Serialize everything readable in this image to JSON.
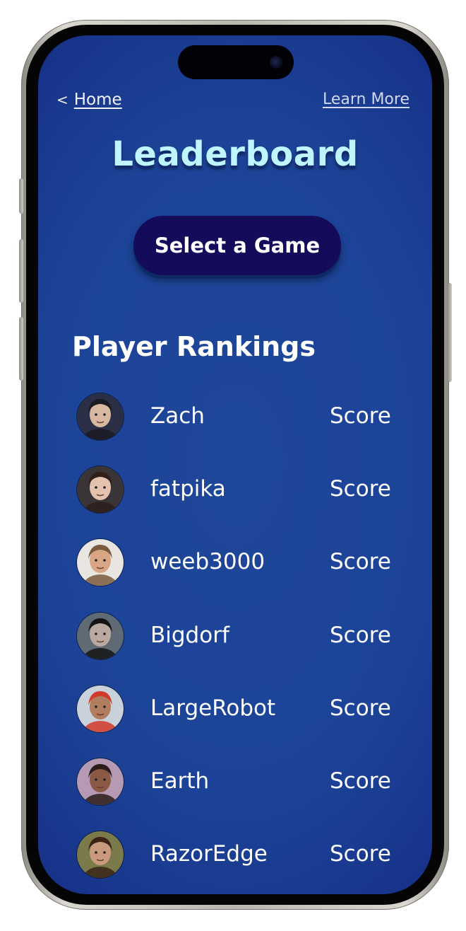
{
  "nav": {
    "back_arrow": "<",
    "home_label": "Home",
    "learn_more_label": "Learn More"
  },
  "page": {
    "title": "Leaderboard",
    "select_game_label": "Select a Game",
    "section_title": "Player Rankings"
  },
  "players": [
    {
      "name": "Zach",
      "score": "Score",
      "avatar_bg": "#2a2f45",
      "skin": "#d9b8a2",
      "hair": "#1a1a22"
    },
    {
      "name": "fatpika",
      "score": "Score",
      "avatar_bg": "#3b3437",
      "skin": "#e3c3b0",
      "hair": "#2e1f1b"
    },
    {
      "name": "weeb3000",
      "score": "Score",
      "avatar_bg": "#e9e6e2",
      "skin": "#d8a585",
      "hair": "#7a5a3c"
    },
    {
      "name": "Bigdorf",
      "score": "Score",
      "avatar_bg": "#5f6a74",
      "skin": "#b9a9a0",
      "hair": "#141414"
    },
    {
      "name": "LargeRobot",
      "score": "Score",
      "avatar_bg": "#c9d1da",
      "skin": "#b07d5e",
      "hair": "#d23a2a"
    },
    {
      "name": "Earth",
      "score": "Score",
      "avatar_bg": "#b69ab3",
      "skin": "#8a5a45",
      "hair": "#2b1d1a"
    },
    {
      "name": "RazorEdge",
      "score": "Score",
      "avatar_bg": "#7a7a4a",
      "skin": "#c99a7e",
      "hair": "#3a2418"
    }
  ],
  "colors": {
    "screen_bg": "#1c4397",
    "title_text": "#bff5ff",
    "button_bg": "#140c5a",
    "text": "#ffffff"
  },
  "icons": {
    "back": "chevron-left-icon",
    "camera": "front-camera-icon"
  }
}
